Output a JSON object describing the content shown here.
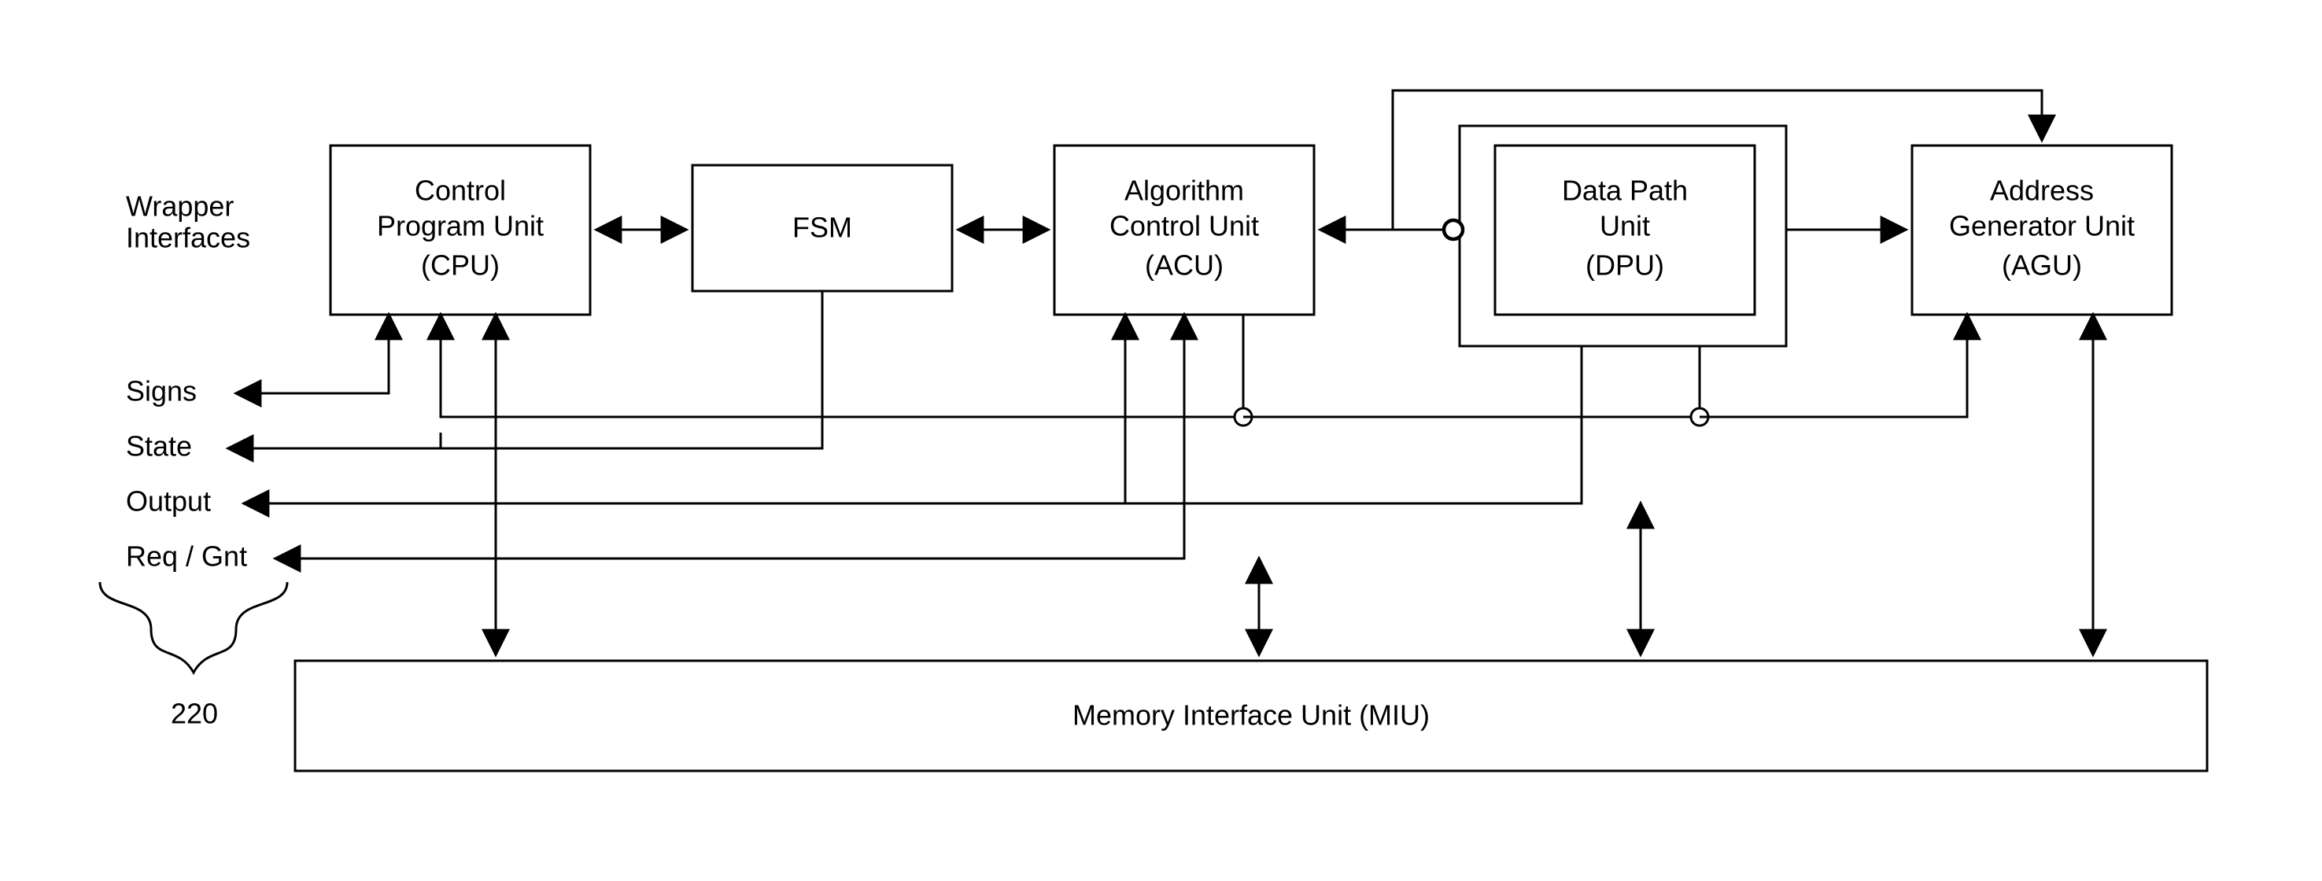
{
  "wrapper": {
    "title_l1": "Wrapper",
    "title_l2": "Interfaces",
    "signs": "Signs",
    "state": "State",
    "output": "Output",
    "reqgnt": "Req / Gnt",
    "num": "220"
  },
  "blocks": {
    "cpu_l1": "Control",
    "cpu_l2": "Program Unit",
    "cpu_l3": "(CPU)",
    "fsm": "FSM",
    "acu_l1": "Algorithm",
    "acu_l2": "Control Unit",
    "acu_l3": "(ACU)",
    "dpu_l1": "Data Path",
    "dpu_l2": "Unit",
    "dpu_l3": "(DPU)",
    "agu_l1": "Address",
    "agu_l2": "Generator Unit",
    "agu_l3": "(AGU)",
    "miu": "Memory Interface Unit (MIU)"
  }
}
